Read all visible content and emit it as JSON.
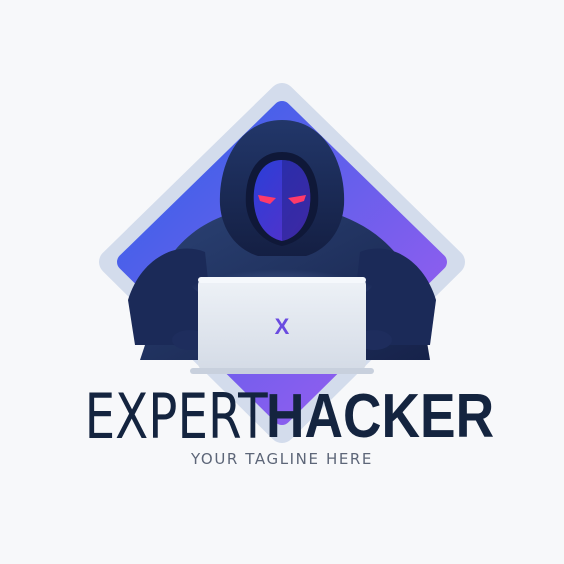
{
  "logo": {
    "laptop_mark": "X",
    "brand_light": "EXPERT",
    "brand_bold": "HACKER",
    "tagline": "YOUR TAGLINE HERE",
    "icon": "hooded-hacker-icon"
  },
  "colors": {
    "background": "#f7f8fa",
    "diamond_gradient_start": "#2f62e8",
    "diamond_gradient_end": "#a45cf0",
    "hoodie_dark": "#121d3c",
    "hoodie_mid": "#2a4072",
    "face": "#3b2fc8",
    "eyes": "#ff3a6a",
    "laptop": "#dfe5ee",
    "laptop_mark": "#6a4be0",
    "wordmark": "#14243f",
    "tagline": "#5d6678"
  }
}
